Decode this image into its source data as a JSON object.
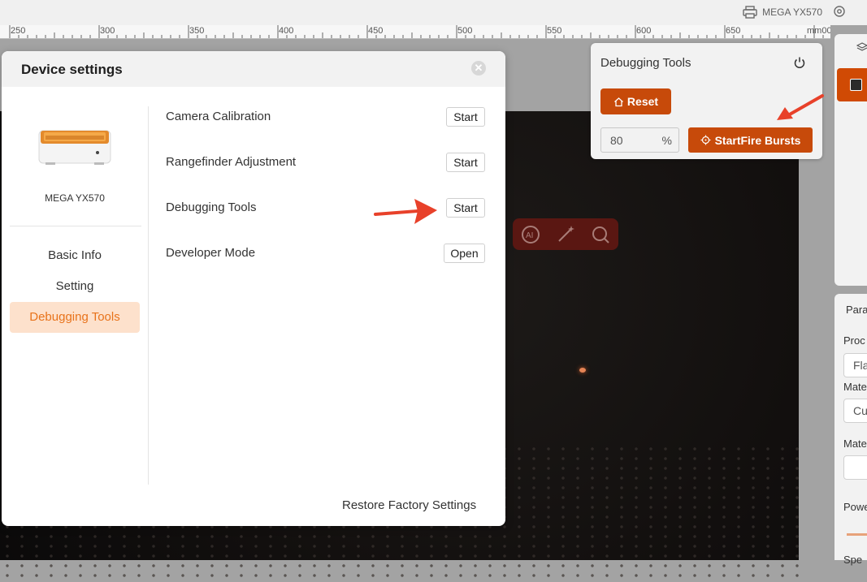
{
  "topbar": {
    "device_name": "MEGA YX570",
    "icons": [
      "printer-icon",
      "gear-icon"
    ]
  },
  "ruler": {
    "labels": [
      "250",
      "300",
      "350",
      "400",
      "450",
      "500",
      "550",
      "600",
      "650",
      "mm00"
    ]
  },
  "debug_panel": {
    "title": "Debugging Tools",
    "reset_label": "Reset",
    "percent_value": "80",
    "percent_unit": "%",
    "fire_label": "StartFire Bursts",
    "icons": [
      "power-icon",
      "home-icon",
      "crosshair-icon"
    ]
  },
  "modal": {
    "title": "Device settings",
    "device_name": "MEGA YX570",
    "nav": [
      {
        "label": "Basic Info",
        "active": false
      },
      {
        "label": "Setting",
        "active": false
      },
      {
        "label": "Debugging Tools",
        "active": true
      }
    ],
    "rows": [
      {
        "label": "Camera Calibration",
        "button": "Start"
      },
      {
        "label": "Rangefinder Adjustment",
        "button": "Start"
      },
      {
        "label": "Debugging Tools",
        "button": "Start"
      },
      {
        "label": "Developer Mode",
        "button": "Open"
      }
    ],
    "restore_label": "Restore Factory Settings"
  },
  "right_panel": {
    "labels": [
      "Para",
      "Proc",
      "Fla",
      "Mate",
      "Cu",
      "Mate",
      "Powe",
      "Spe"
    ]
  },
  "colors": {
    "accent": "#c74a0a",
    "accent_light": "#fde1cc",
    "arrow": "#e8412a"
  }
}
